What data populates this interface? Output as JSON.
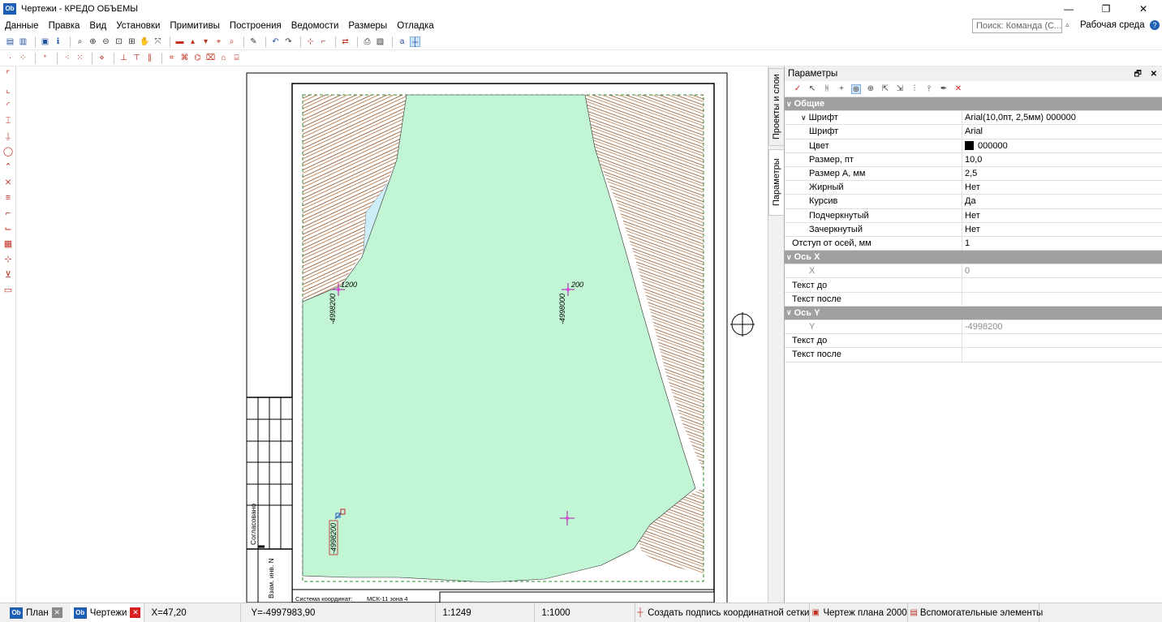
{
  "window": {
    "title": "Чертежи - КРЕДО ОБЪЕМЫ",
    "logo_text": "Ob",
    "minimize": "—",
    "maximize": "❐",
    "close": "✕"
  },
  "menu": {
    "items": [
      "Данные",
      "Правка",
      "Вид",
      "Установки",
      "Примитивы",
      "Построения",
      "Ведомости",
      "Размеры",
      "Отладка"
    ],
    "search_placeholder": "Поиск: Команда (С...",
    "workspace_label": "Рабочая среда",
    "help_icon": "?"
  },
  "side_tabs": {
    "projects": "Проекты и слои",
    "params": "Параметры"
  },
  "params_panel": {
    "title": "Параметры",
    "groups": [
      {
        "label": "Общие",
        "type": "group"
      },
      {
        "label": "Шрифт",
        "value": "Arial(10,0пт, 2,5мм) 000000",
        "type": "lvl1"
      },
      {
        "label": "Шрифт",
        "value": "Arial",
        "type": "lvl2"
      },
      {
        "label": "Цвет",
        "value": "000000",
        "type": "lvl2",
        "swatch": "#000000"
      },
      {
        "label": "Размер, пт",
        "value": "10,0",
        "type": "lvl2"
      },
      {
        "label": "Размер А, мм",
        "value": "2,5",
        "type": "lvl2"
      },
      {
        "label": "Жирный",
        "value": "Нет",
        "type": "lvl2"
      },
      {
        "label": "Курсив",
        "value": "Да",
        "type": "lvl2"
      },
      {
        "label": "Подчеркнутый",
        "value": "Нет",
        "type": "lvl2"
      },
      {
        "label": "Зачеркнутый",
        "value": "Нет",
        "type": "lvl2"
      },
      {
        "label": "Отступ от осей, мм",
        "value": "1",
        "type": "lvl1b"
      },
      {
        "label": "Ось X",
        "type": "group"
      },
      {
        "label": "X",
        "value": "0",
        "type": "lvl2d"
      },
      {
        "label": "Текст до",
        "value": "",
        "type": "lvl1b"
      },
      {
        "label": "Текст после",
        "value": "",
        "type": "lvl1b"
      },
      {
        "label": "Ось Y",
        "type": "group"
      },
      {
        "label": "Y",
        "value": "-4998200",
        "type": "lvl2d"
      },
      {
        "label": "Текст до",
        "value": "",
        "type": "lvl1b"
      },
      {
        "label": "Текст после",
        "value": "",
        "type": "lvl1b"
      }
    ]
  },
  "drawing": {
    "grid_labels": {
      "top_left_x": "1200",
      "top_left_y": "-4998200",
      "top_mid_x": "200",
      "top_mid_y": "-4998000",
      "bottom_left_y": "-4998200"
    },
    "stamp": {
      "agreed": "Согласовано",
      "inv": "Взам. инв. N",
      "coord_system_label": "Система координат:",
      "coord_system_value": "МСК-11 зона 4"
    }
  },
  "statusbar": {
    "tab_plan": "План",
    "tab_drawings": "Чертежи",
    "x": "X=47,20",
    "y": "Y=-4997983,90",
    "scale1": "1:1249",
    "scale2": "1:1000",
    "command": "Создать подпись координатной сетки",
    "layer": "Чертеж плана 2000",
    "aux": "Вспомогательные элементы"
  }
}
